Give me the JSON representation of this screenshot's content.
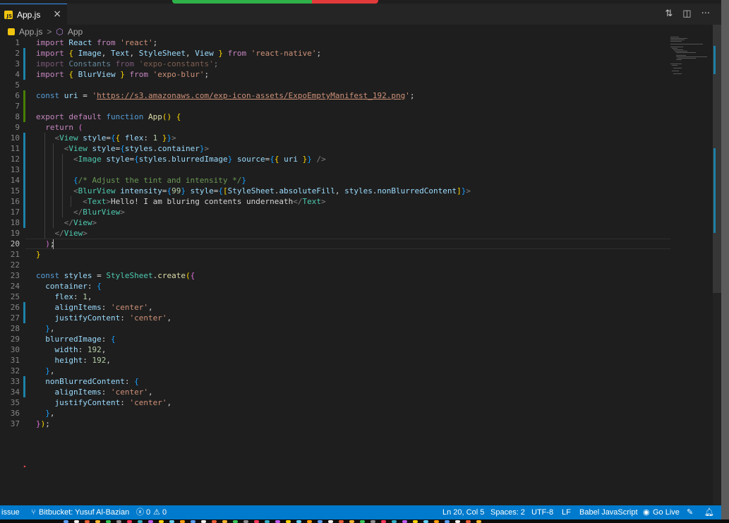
{
  "top_indicator": {
    "ok_color": "#2fb14a",
    "error_color": "#e23a3a"
  },
  "tab": {
    "file_icon": "js-file-icon",
    "label": "App.js",
    "close": "×"
  },
  "tab_actions": [
    {
      "name": "compare-changes-icon",
      "glyph": "⇅"
    },
    {
      "name": "split-editor-icon",
      "glyph": "◫"
    },
    {
      "name": "more-actions-icon",
      "glyph": "···"
    }
  ],
  "breadcrumb": {
    "file": "App.js",
    "separator": ">",
    "symbol": "App"
  },
  "editor": {
    "lines": [
      {
        "n": "1",
        "html": "<span class=\"ctl\">import</span> <span class=\"var\">React</span> <span class=\"ctl\">from</span> <span class=\"str\">'react'</span>;"
      },
      {
        "n": "2",
        "html": "<span class=\"ctl\">import</span> <span class=\"br1\">{</span> <span class=\"var\">Image</span>, <span class=\"var\">Text</span>, <span class=\"var\">StyleSheet</span>, <span class=\"var\">View</span> <span class=\"br1\">}</span> <span class=\"ctl\">from</span> <span class=\"str\">'react-native'</span>;"
      },
      {
        "n": "3",
        "html": "<span class=\"faded\"><span class=\"ctl\">import</span> <span class=\"var\">Constants</span> <span class=\"ctl\">from</span> <span class=\"str\">'expo-constants'</span>;</span>"
      },
      {
        "n": "4",
        "html": "<span class=\"ctl\">import</span> <span class=\"br1\">{</span> <span class=\"var\">BlurView</span> <span class=\"br1\">}</span> <span class=\"ctl\">from</span> <span class=\"str\">'expo-blur'</span>;"
      },
      {
        "n": "5",
        "html": ""
      },
      {
        "n": "6",
        "html": "<span class=\"kw\">const</span> <span class=\"var\">uri</span> = <span class=\"str\">'</span><span class=\"url\">https://s3.amazonaws.com/exp-icon-assets/ExpoEmptyManifest_192.png</span><span class=\"str\">'</span>;"
      },
      {
        "n": "7",
        "html": ""
      },
      {
        "n": "8",
        "html": "<span class=\"ctl\">export</span> <span class=\"ctl\">default</span> <span class=\"kw\">function</span> <span class=\"fn\">App</span><span class=\"br1\">()</span> <span class=\"br1\">{</span>"
      },
      {
        "n": "9",
        "html": "  <span class=\"ctl\">return</span> <span class=\"br2\">(</span>"
      },
      {
        "n": "10",
        "html": "    <span class=\"punc\">&lt;</span><span class=\"tag\">View</span> <span class=\"var\">style</span>=<span class=\"br3\">{</span><span class=\"br1\">{</span> <span class=\"var\">flex</span>: <span class=\"num\">1</span> <span class=\"br1\">}</span><span class=\"br3\">}</span><span class=\"punc\">&gt;</span>"
      },
      {
        "n": "11",
        "html": "      <span class=\"punc\">&lt;</span><span class=\"tag\">View</span> <span class=\"var\">style</span>=<span class=\"br3\">{</span><span class=\"var\">styles</span>.<span class=\"var\">container</span><span class=\"br3\">}</span><span class=\"punc\">&gt;</span>"
      },
      {
        "n": "12",
        "html": "        <span class=\"punc\">&lt;</span><span class=\"tag\">Image</span> <span class=\"var\">style</span>=<span class=\"br3\">{</span><span class=\"var\">styles</span>.<span class=\"var\">blurredImage</span><span class=\"br3\">}</span> <span class=\"var\">source</span>=<span class=\"br3\">{</span><span class=\"br1\">{</span> <span class=\"var\">uri</span> <span class=\"br1\">}</span><span class=\"br3\">}</span> <span class=\"punc\">/&gt;</span>"
      },
      {
        "n": "13",
        "html": ""
      },
      {
        "n": "14",
        "html": "        <span class=\"br3\">{</span><span class=\"cmt\">/* Adjust the tint and intensity */</span><span class=\"br3\">}</span>"
      },
      {
        "n": "15",
        "html": "        <span class=\"punc\">&lt;</span><span class=\"tag\">BlurView</span> <span class=\"var\">intensity</span>=<span class=\"br3\">{</span><span class=\"num\">99</span><span class=\"br3\">}</span> <span class=\"var\">style</span>=<span class=\"br3\">{</span><span class=\"br1\">[</span><span class=\"var\">StyleSheet</span>.<span class=\"var\">absoluteFill</span>, <span class=\"var\">styles</span>.<span class=\"var\">nonBlurredContent</span><span class=\"br1\">]</span><span class=\"br3\">}</span><span class=\"punc\">&gt;</span>"
      },
      {
        "n": "16",
        "html": "          <span class=\"punc\">&lt;</span><span class=\"tag\">Text</span><span class=\"punc\">&gt;</span>Hello! I am bluring contents underneath<span class=\"punc\">&lt;/</span><span class=\"tag\">Text</span><span class=\"punc\">&gt;</span>"
      },
      {
        "n": "17",
        "html": "        <span class=\"punc\">&lt;/</span><span class=\"tag\">BlurView</span><span class=\"punc\">&gt;</span>"
      },
      {
        "n": "18",
        "html": "      <span class=\"punc\">&lt;/</span><span class=\"tag\">View</span><span class=\"punc\">&gt;</span>"
      },
      {
        "n": "19",
        "html": "    <span class=\"punc\">&lt;/</span><span class=\"tag\">View</span><span class=\"punc\">&gt;</span>"
      },
      {
        "n": "20",
        "html": "  <span class=\"br2\">)</span>;"
      },
      {
        "n": "21",
        "html": "<span class=\"br1\">}</span>"
      },
      {
        "n": "22",
        "html": ""
      },
      {
        "n": "23",
        "html": "<span class=\"kw\">const</span> <span class=\"var\">styles</span> = <span class=\"cls\">StyleSheet</span>.<span class=\"fn\">create</span><span class=\"br1\">(</span><span class=\"br2\">{</span>"
      },
      {
        "n": "24",
        "html": "  <span class=\"var\">container</span>: <span class=\"br3\">{</span>"
      },
      {
        "n": "25",
        "html": "    <span class=\"var\">flex</span>: <span class=\"num\">1</span>,"
      },
      {
        "n": "26",
        "html": "    <span class=\"var\">alignItems</span>: <span class=\"str\">'center'</span>,"
      },
      {
        "n": "27",
        "html": "    <span class=\"var\">justifyContent</span>: <span class=\"str\">'center'</span>,"
      },
      {
        "n": "28",
        "html": "  <span class=\"br3\">}</span>,"
      },
      {
        "n": "29",
        "html": "  <span class=\"var\">blurredImage</span>: <span class=\"br3\">{</span>"
      },
      {
        "n": "30",
        "html": "    <span class=\"var\">width</span>: <span class=\"num\">192</span>,"
      },
      {
        "n": "31",
        "html": "    <span class=\"var\">height</span>: <span class=\"num\">192</span>,"
      },
      {
        "n": "32",
        "html": "  <span class=\"br3\">}</span>,"
      },
      {
        "n": "33",
        "html": "  <span class=\"var\">nonBlurredContent</span>: <span class=\"br3\">{</span>"
      },
      {
        "n": "34",
        "html": "    <span class=\"var\">alignItems</span>: <span class=\"str\">'center'</span>,"
      },
      {
        "n": "35",
        "html": "    <span class=\"var\">justifyContent</span>: <span class=\"str\">'center'</span>,"
      },
      {
        "n": "36",
        "html": "  <span class=\"br3\">}</span>,"
      },
      {
        "n": "37",
        "html": "<span class=\"br2\">}</span><span class=\"br1\">)</span>;"
      }
    ],
    "current_line": "20",
    "gutter_colors": {
      "modified": "#1b81a8",
      "added": "#487e02"
    }
  },
  "status": {
    "issue": "issue",
    "branch_icon": "source-control-icon",
    "bitbucket": "Bitbucket: Yusuf Al-Bazian",
    "errors": "0",
    "warnings": "0",
    "cursor": "Ln 20, Col 5",
    "spaces": "Spaces: 2",
    "encoding": "UTF-8",
    "eol": "LF",
    "language": "Babel JavaScript",
    "golive": "Go Live",
    "bg_color": "#007acc"
  }
}
